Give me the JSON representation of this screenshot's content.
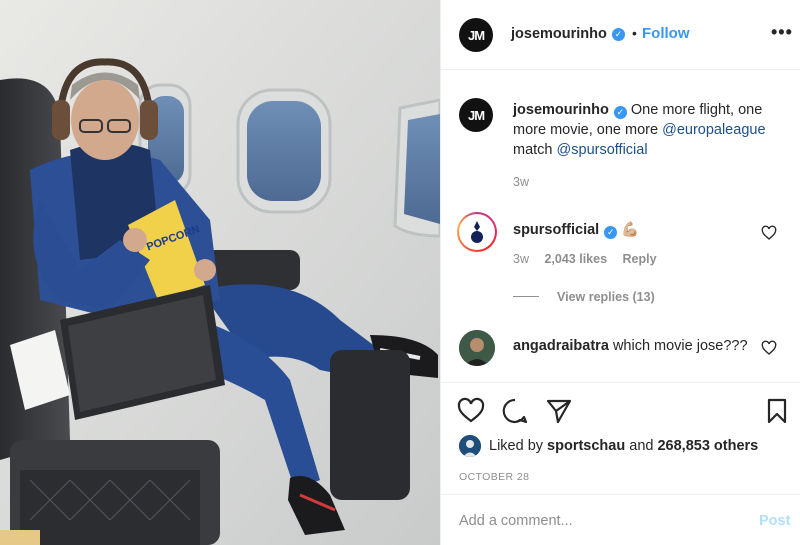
{
  "post": {
    "username": "josemourinho",
    "avatar_initials": "JM",
    "follow_label": "Follow",
    "separator": "•",
    "more_label": "•••"
  },
  "caption": {
    "username": "josemourinho",
    "text_before": "One more flight, one more movie, one more",
    "mention_1": "@europaleague",
    "text_middle": "match",
    "mention_2": "@spursofficial",
    "time": "3w"
  },
  "comments": [
    {
      "username": "spursofficial",
      "emoji": "💪🏼",
      "time": "3w",
      "likes": "2,043 likes",
      "reply_label": "Reply",
      "view_replies": "View replies (13)"
    },
    {
      "username": "angadraibatra",
      "text": "which movie jose???"
    }
  ],
  "actions": {
    "liked_by_prefix": "Liked by",
    "liked_by_user": "sportschau",
    "liked_by_and": "and",
    "liked_by_count": "268,853 others",
    "date": "OCTOBER 28"
  },
  "comment_box": {
    "placeholder": "Add a comment...",
    "post_label": "Post"
  },
  "photo": {
    "bag_text": "POPCORN"
  },
  "colors": {
    "accent": "#3897f0",
    "post_disabled": "#b2dffc",
    "secondary_text": "#8e8e8e"
  }
}
